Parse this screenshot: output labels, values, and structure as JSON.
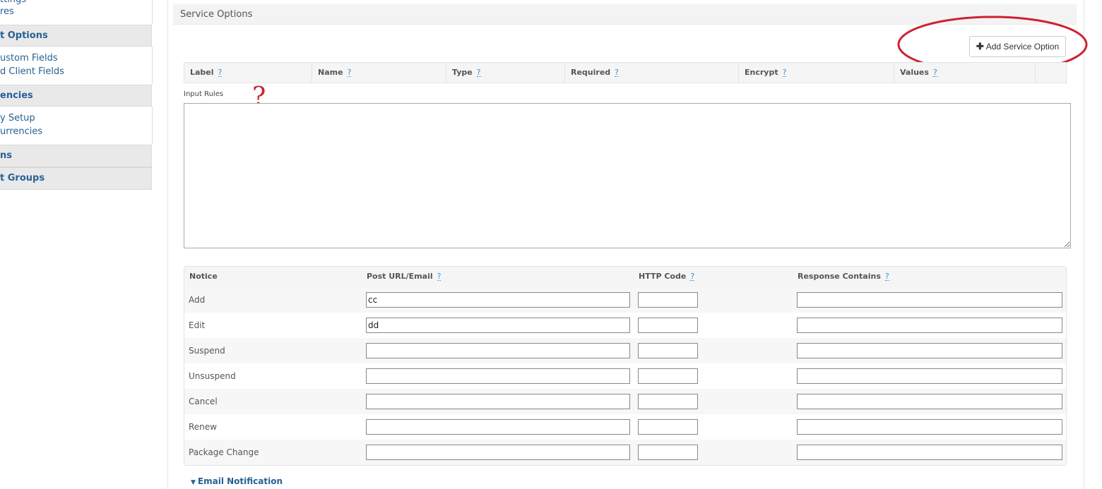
{
  "sidebar": {
    "groups": [
      {
        "links": [
          "ttings",
          "res"
        ]
      },
      {
        "title": "t Options",
        "links": [
          "ustom Fields",
          "d Client Fields"
        ]
      },
      {
        "title": "encies",
        "links": [
          "y Setup",
          "urrencies"
        ]
      },
      {
        "title": "ns",
        "links": []
      },
      {
        "title": "t Groups",
        "links": []
      }
    ]
  },
  "section": {
    "title": "Service Options"
  },
  "add_button": {
    "label": "Add Service Option",
    "icon": "plus-icon"
  },
  "annotation": {
    "ring_color": "#cc2233",
    "question_mark": "?"
  },
  "options_table": {
    "columns": [
      "Label",
      "Name",
      "Type",
      "Required",
      "Encrypt",
      "Values"
    ],
    "help": "?"
  },
  "input_rules": {
    "label": "Input Rules",
    "value": ""
  },
  "notice_table": {
    "columns": [
      "Notice",
      "Post URL/Email",
      "HTTP Code",
      "Response Contains"
    ],
    "help": "?",
    "rows": [
      {
        "label": "Add",
        "url": "cc",
        "code": "",
        "response": ""
      },
      {
        "label": "Edit",
        "url": "dd",
        "code": "",
        "response": ""
      },
      {
        "label": "Suspend",
        "url": "",
        "code": "",
        "response": ""
      },
      {
        "label": "Unsuspend",
        "url": "",
        "code": "",
        "response": ""
      },
      {
        "label": "Cancel",
        "url": "",
        "code": "",
        "response": ""
      },
      {
        "label": "Renew",
        "url": "",
        "code": "",
        "response": ""
      },
      {
        "label": "Package Change",
        "url": "",
        "code": "",
        "response": ""
      }
    ]
  },
  "email_notification": {
    "label": "Email Notification",
    "icon": "caret-down-icon"
  },
  "colors": {
    "link": "#276194",
    "help": "#3a8ec8",
    "annotation": "#cc2233"
  }
}
